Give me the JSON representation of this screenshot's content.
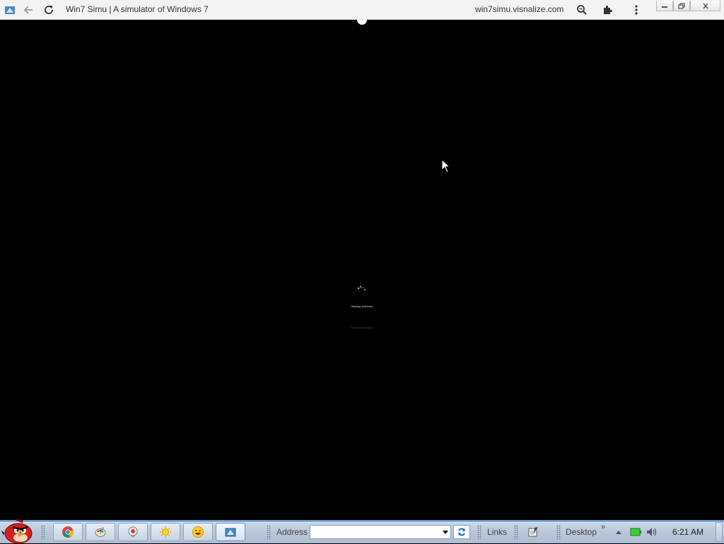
{
  "browser": {
    "title": "Win7 Simu | A simulator of Windows 7",
    "url": "win7simu.visnalize.com",
    "icons": [
      "app-icon",
      "back-arrow-icon",
      "reload-icon",
      "zoom-icon",
      "extensions-icon",
      "menu-kebab-icon"
    ],
    "window_controls": [
      "minimize",
      "restore",
      "close"
    ]
  },
  "boot": {
    "status_text": "Starting Windows",
    "copyright_text": "© Microsoft Corporation"
  },
  "taskbar": {
    "start_icon": "angry-bird-icon",
    "pinned": [
      {
        "name": "chrome",
        "icon": "chrome-icon"
      },
      {
        "name": "paint",
        "icon": "paint-icon"
      },
      {
        "name": "media",
        "icon": "media-icon"
      },
      {
        "name": "weather",
        "icon": "sun-icon"
      },
      {
        "name": "emoji",
        "icon": "smiley-icon"
      },
      {
        "name": "win7simu",
        "icon": "win7simu-icon",
        "active": true
      }
    ],
    "address_label": "Address",
    "address_value": "",
    "links_label": "Links",
    "desktop_label": "Desktop",
    "chevron": "»",
    "clock": "6:21 AM"
  },
  "colors": {
    "taskbar_top": "#ced9e8",
    "taskbar_border": "#2a6cc4",
    "browser_bar": "#f3f3f3",
    "boot_bg": "#000000"
  }
}
